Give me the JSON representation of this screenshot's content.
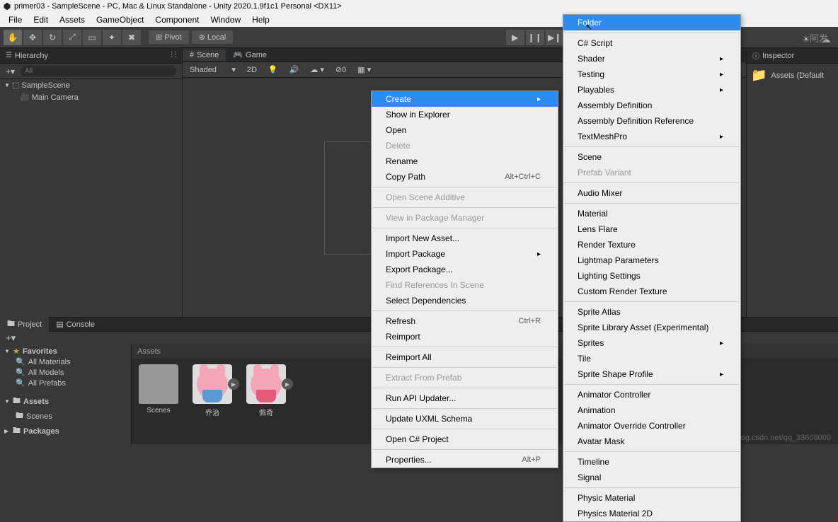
{
  "title": "primer03 - SampleScene - PC, Mac & Linux Standalone - Unity 2020.1.9f1c1 Personal <DX11>",
  "menubar": [
    "File",
    "Edit",
    "Assets",
    "GameObject",
    "Component",
    "Window",
    "Help"
  ],
  "toolbar": {
    "pivot": "Pivot",
    "local": "Local"
  },
  "hierarchy": {
    "title": "Hierarchy",
    "search_placeholder": "All",
    "scene": "SampleScene",
    "camera": "Main Camera"
  },
  "scene": {
    "tab_scene": "Scene",
    "tab_game": "Game",
    "shaded": "Shaded",
    "mode_2d": "2D"
  },
  "inspector": {
    "title": "Inspector",
    "assets_default": "Assets (Default"
  },
  "project": {
    "tab_project": "Project",
    "tab_console": "Console",
    "favorites": "Favorites",
    "all_materials": "All Materials",
    "all_models": "All Models",
    "all_prefabs": "All Prefabs",
    "assets": "Assets",
    "scenes": "Scenes",
    "packages": "Packages",
    "header": "Assets"
  },
  "assets_grid": [
    {
      "name": "Scenes",
      "type": "folder"
    },
    {
      "name": "乔治",
      "type": "pig",
      "dress": "#5a9bd4"
    },
    {
      "name": "佩奇",
      "type": "pig",
      "dress": "#e85a7a"
    }
  ],
  "context_menu1": [
    {
      "label": "Create",
      "highlighted": true,
      "submenu": true
    },
    {
      "label": "Show in Explorer"
    },
    {
      "label": "Open"
    },
    {
      "label": "Delete",
      "disabled": true
    },
    {
      "label": "Rename"
    },
    {
      "label": "Copy Path",
      "shortcut": "Alt+Ctrl+C"
    },
    {
      "sep": true
    },
    {
      "label": "Open Scene Additive",
      "disabled": true
    },
    {
      "sep": true
    },
    {
      "label": "View in Package Manager",
      "disabled": true
    },
    {
      "sep": true
    },
    {
      "label": "Import New Asset..."
    },
    {
      "label": "Import Package",
      "submenu": true
    },
    {
      "label": "Export Package..."
    },
    {
      "label": "Find References In Scene",
      "disabled": true
    },
    {
      "label": "Select Dependencies"
    },
    {
      "sep": true
    },
    {
      "label": "Refresh",
      "shortcut": "Ctrl+R"
    },
    {
      "label": "Reimport"
    },
    {
      "sep": true
    },
    {
      "label": "Reimport All"
    },
    {
      "sep": true
    },
    {
      "label": "Extract From Prefab",
      "disabled": true
    },
    {
      "sep": true
    },
    {
      "label": "Run API Updater..."
    },
    {
      "sep": true
    },
    {
      "label": "Update UXML Schema"
    },
    {
      "sep": true
    },
    {
      "label": "Open C# Project"
    },
    {
      "sep": true
    },
    {
      "label": "Properties...",
      "shortcut": "Alt+P"
    }
  ],
  "context_menu2": [
    {
      "label": "Folder",
      "highlighted": true
    },
    {
      "sep": true
    },
    {
      "label": "C# Script"
    },
    {
      "label": "Shader",
      "submenu": true
    },
    {
      "label": "Testing",
      "submenu": true
    },
    {
      "label": "Playables",
      "submenu": true
    },
    {
      "label": "Assembly Definition"
    },
    {
      "label": "Assembly Definition Reference"
    },
    {
      "label": "TextMeshPro",
      "submenu": true
    },
    {
      "sep": true
    },
    {
      "label": "Scene"
    },
    {
      "label": "Prefab Variant",
      "disabled": true
    },
    {
      "sep": true
    },
    {
      "label": "Audio Mixer"
    },
    {
      "sep": true
    },
    {
      "label": "Material"
    },
    {
      "label": "Lens Flare"
    },
    {
      "label": "Render Texture"
    },
    {
      "label": "Lightmap Parameters"
    },
    {
      "label": "Lighting Settings"
    },
    {
      "label": "Custom Render Texture"
    },
    {
      "sep": true
    },
    {
      "label": "Sprite Atlas"
    },
    {
      "label": "Sprite Library Asset (Experimental)"
    },
    {
      "label": "Sprites",
      "submenu": true
    },
    {
      "label": "Tile"
    },
    {
      "label": "Sprite Shape Profile",
      "submenu": true
    },
    {
      "sep": true
    },
    {
      "label": "Animator Controller"
    },
    {
      "label": "Animation"
    },
    {
      "label": "Animator Override Controller"
    },
    {
      "label": "Avatar Mask"
    },
    {
      "sep": true
    },
    {
      "label": "Timeline"
    },
    {
      "label": "Signal"
    },
    {
      "sep": true
    },
    {
      "label": "Physic Material"
    },
    {
      "label": "Physics Material 2D"
    }
  ],
  "watermark": "https://blog.csdn.net/qq_33608000",
  "watermark2": "阿发"
}
